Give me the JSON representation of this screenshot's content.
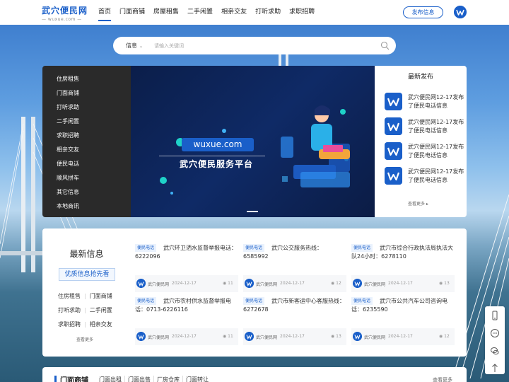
{
  "header": {
    "logo_main": "武穴便民网",
    "logo_sub": "— wuxue.com —",
    "nav": [
      "首页",
      "门面商铺",
      "房屋租售",
      "二手闲置",
      "相亲交友",
      "打听求助",
      "求职招聘"
    ],
    "active_nav": "首页",
    "publish_label": "发布信息"
  },
  "search": {
    "category": "信息",
    "placeholder": "请输入关键词"
  },
  "categories": [
    "住房租售",
    "门面商铺",
    "打听求助",
    "二手闲置",
    "求职招聘",
    "相亲交友",
    "便民电话",
    "顺风拼车",
    "其它信息",
    "本地商讯"
  ],
  "banner": {
    "domain": "wuxue.com",
    "title": "武穴便民服务平台"
  },
  "latest": {
    "title": "最新发布",
    "items": [
      "武穴便民网12-17发布了便民电话信息",
      "武穴便民网12-17发布了便民电话信息",
      "武穴便民网12-17发布了便民电话信息",
      "武穴便民网12-17发布了便民电话信息"
    ],
    "more": "查看更多"
  },
  "info": {
    "title": "最新信息",
    "promo": "优质信息抢先看",
    "links": [
      [
        "住房租售",
        "门面商铺"
      ],
      [
        "打听求助",
        "二手闲置"
      ],
      [
        "求职招聘",
        "相亲交友"
      ]
    ],
    "more": "查看更多",
    "cards": [
      {
        "tag": "便民电话",
        "text": "武穴环卫洒水监督举报电话：6222096",
        "source": "武穴便民网",
        "date": "2024-12-17",
        "views": "11"
      },
      {
        "tag": "便民电话",
        "text": "武穴公交服务热线：6585992",
        "source": "武穴便民网",
        "date": "2024-12-17",
        "views": "12"
      },
      {
        "tag": "便民电话",
        "text": "武穴市综合行政执法局执法大队24小时：6278110",
        "source": "武穴便民网",
        "date": "2024-12-17",
        "views": "13"
      },
      {
        "tag": "便民电话",
        "text": "武穴市农村供水监督举报电话：0713-6226116",
        "source": "武穴便民网",
        "date": "2024-12-17",
        "views": "11"
      },
      {
        "tag": "便民电话",
        "text": "武穴市新客运中心客服热线：6272678",
        "source": "武穴便民网",
        "date": "2024-12-17",
        "views": "13"
      },
      {
        "tag": "便民电话",
        "text": "武穴市公共汽车公司咨询电话：6235590",
        "source": "武穴便民网",
        "date": "2024-12-17",
        "views": "12"
      }
    ]
  },
  "bottom": {
    "title": "门面商铺",
    "tabs": [
      "门面出租",
      "门面出售",
      "厂房仓库",
      "门面转让"
    ],
    "more": "查看更多"
  },
  "colors": {
    "brand": "#1a5fc9"
  }
}
